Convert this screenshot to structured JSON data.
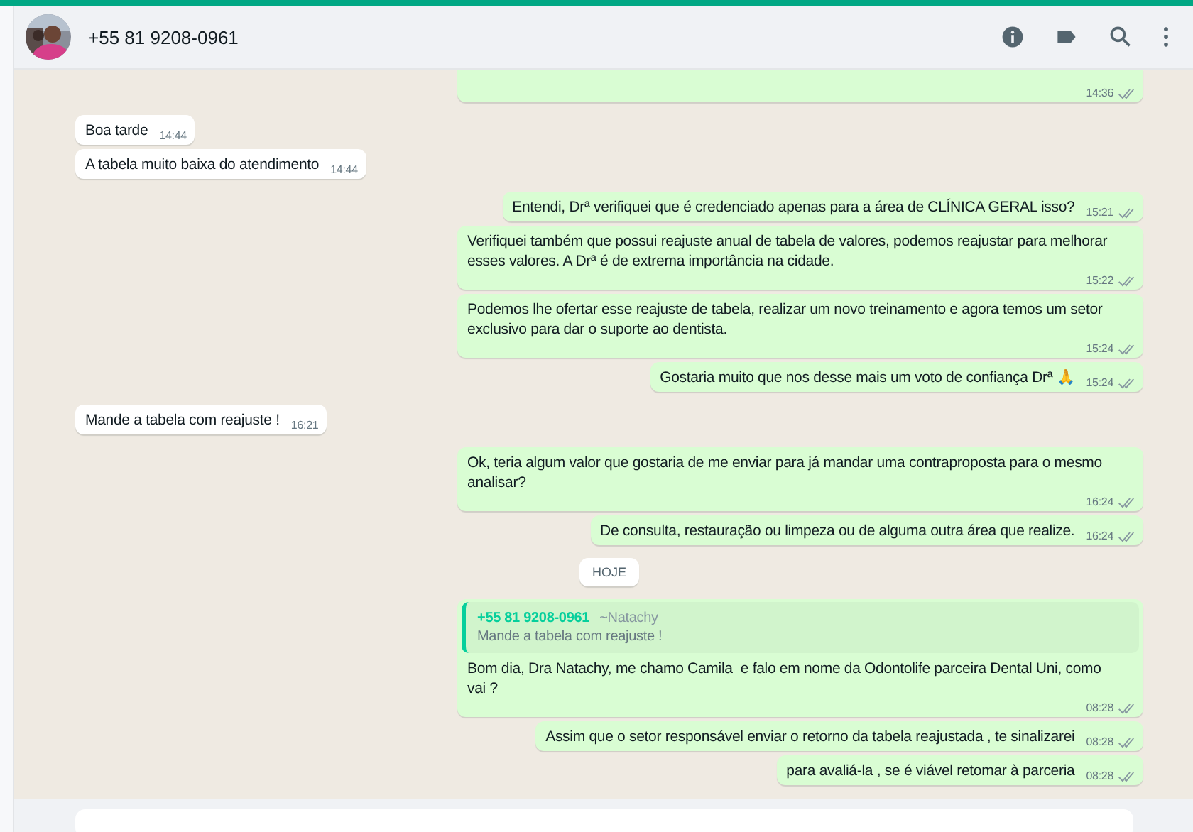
{
  "header": {
    "contact": "+55 81 9208-0961"
  },
  "messages": [
    {
      "kind": "outgoing",
      "time": "14:36"
    },
    {
      "kind": "incoming",
      "text": "Boa tarde",
      "time": "14:44"
    },
    {
      "kind": "incoming",
      "text": "A tabela muito baixa do atendimento",
      "time": "14:44"
    },
    {
      "kind": "outgoing",
      "text": "Entendi, Drª verifiquei que é credenciado apenas para a área de CLÍNICA GERAL isso?",
      "time": "15:21"
    },
    {
      "kind": "outgoing",
      "text": "Verifiquei também que possui reajuste anual de tabela de valores, podemos reajustar para melhorar esses valores. A Drª é de extrema importância na cidade.",
      "time": "15:22"
    },
    {
      "kind": "outgoing",
      "text": "Podemos lhe ofertar esse reajuste de tabela, realizar um novo treinamento e agora temos um setor exclusivo para dar o suporte ao dentista.",
      "time": "15:24"
    },
    {
      "kind": "outgoing",
      "text": "Gostaria muito que nos desse mais um voto de confiança Drª 🙏",
      "time": "15:24"
    },
    {
      "kind": "incoming",
      "text": "Mande a tabela com reajuste !",
      "time": "16:21"
    },
    {
      "kind": "outgoing",
      "text": "Ok, teria algum valor que gostaria de me enviar para já mandar uma contraproposta para o mesmo analisar?",
      "time": "16:24"
    },
    {
      "kind": "outgoing",
      "text": "De consulta, restauração ou limpeza ou de alguma outra área que realize.",
      "time": "16:24"
    },
    {
      "kind": "date",
      "text": "HOJE"
    },
    {
      "kind": "outgoing",
      "quote": {
        "author": "+55 81 9208-0961",
        "alias": "~Natachy",
        "text": "Mande a tabela com reajuste !"
      },
      "text": "Bom dia, Dra Natachy, me chamo Camila  e falo em nome da Odontolife parceira Dental Uni, como vai ?",
      "time": "08:28"
    },
    {
      "kind": "outgoing",
      "text": "Assim que o setor responsável enviar o retorno da tabela reajustada , te sinalizarei",
      "time": "08:28"
    },
    {
      "kind": "outgoing",
      "text": "para avaliá-la , se é viável retomar à parceria",
      "time": "08:28"
    }
  ]
}
